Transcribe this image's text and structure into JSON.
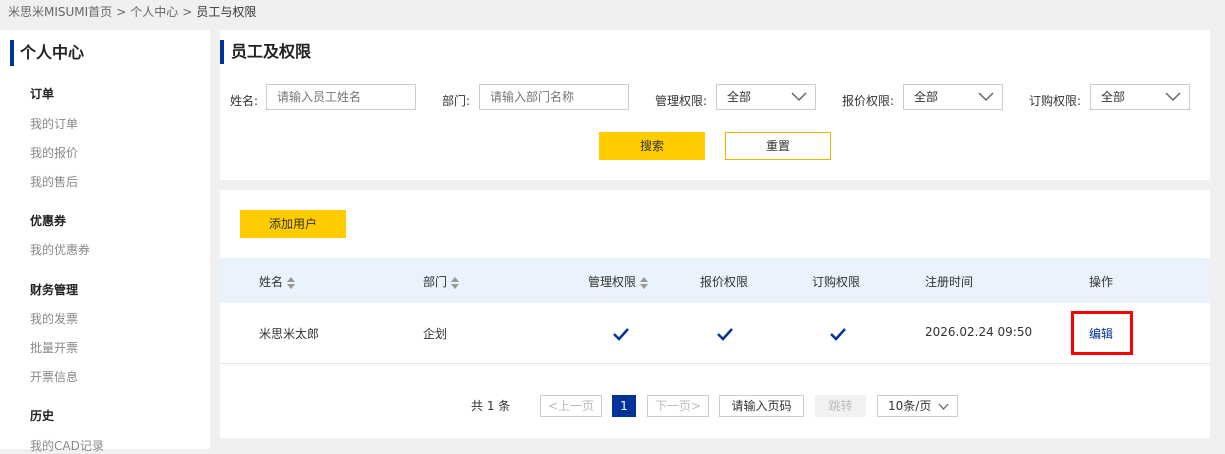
{
  "breadcrumb": {
    "home": "米思米MISUMI首页",
    "parent": "个人中心",
    "current": "员工与权限",
    "separator": ">"
  },
  "sidebar": {
    "title": "个人中心",
    "sections": [
      {
        "title": "订单",
        "items": [
          "我的订单",
          "我的报价",
          "我的售后"
        ]
      },
      {
        "title": "优惠券",
        "items": [
          "我的优惠券"
        ]
      },
      {
        "title": "财务管理",
        "items": [
          "我的发票",
          "批量开票",
          "开票信息"
        ]
      },
      {
        "title": "历史",
        "items": [
          "我的CAD记录"
        ]
      }
    ]
  },
  "search": {
    "title": "员工及权限",
    "name_label": "姓名:",
    "name_placeholder": "请输入员工姓名",
    "dept_label": "部门:",
    "dept_placeholder": "请输入部门名称",
    "manage_label": "管理权限:",
    "manage_value": "全部",
    "quote_label": "报价权限:",
    "quote_value": "全部",
    "order_label": "订购权限:",
    "order_value": "全部",
    "search_button": "搜索",
    "reset_button": "重置"
  },
  "list": {
    "add_button": "添加用户",
    "columns": [
      "姓名",
      "部门",
      "管理权限",
      "报价权限",
      "订购权限",
      "注册时间",
      "操作"
    ],
    "rows": [
      {
        "name": "米思米太郎",
        "dept": "企划",
        "manage": true,
        "quote": true,
        "order": true,
        "registered": "2026.02.24 09:50",
        "action": "编辑"
      }
    ]
  },
  "pagination": {
    "total_text": "共 1 条",
    "prev": "<上一页",
    "current_page": "1",
    "next": "下一页>",
    "page_input_placeholder": "请输入页码",
    "jump": "跳转",
    "page_size": "10条/页"
  },
  "colors": {
    "accent_blue": "#003399",
    "button_yellow": "#ffcc00",
    "highlight_red": "#ff0000",
    "header_bg": "#eaf2fb"
  }
}
